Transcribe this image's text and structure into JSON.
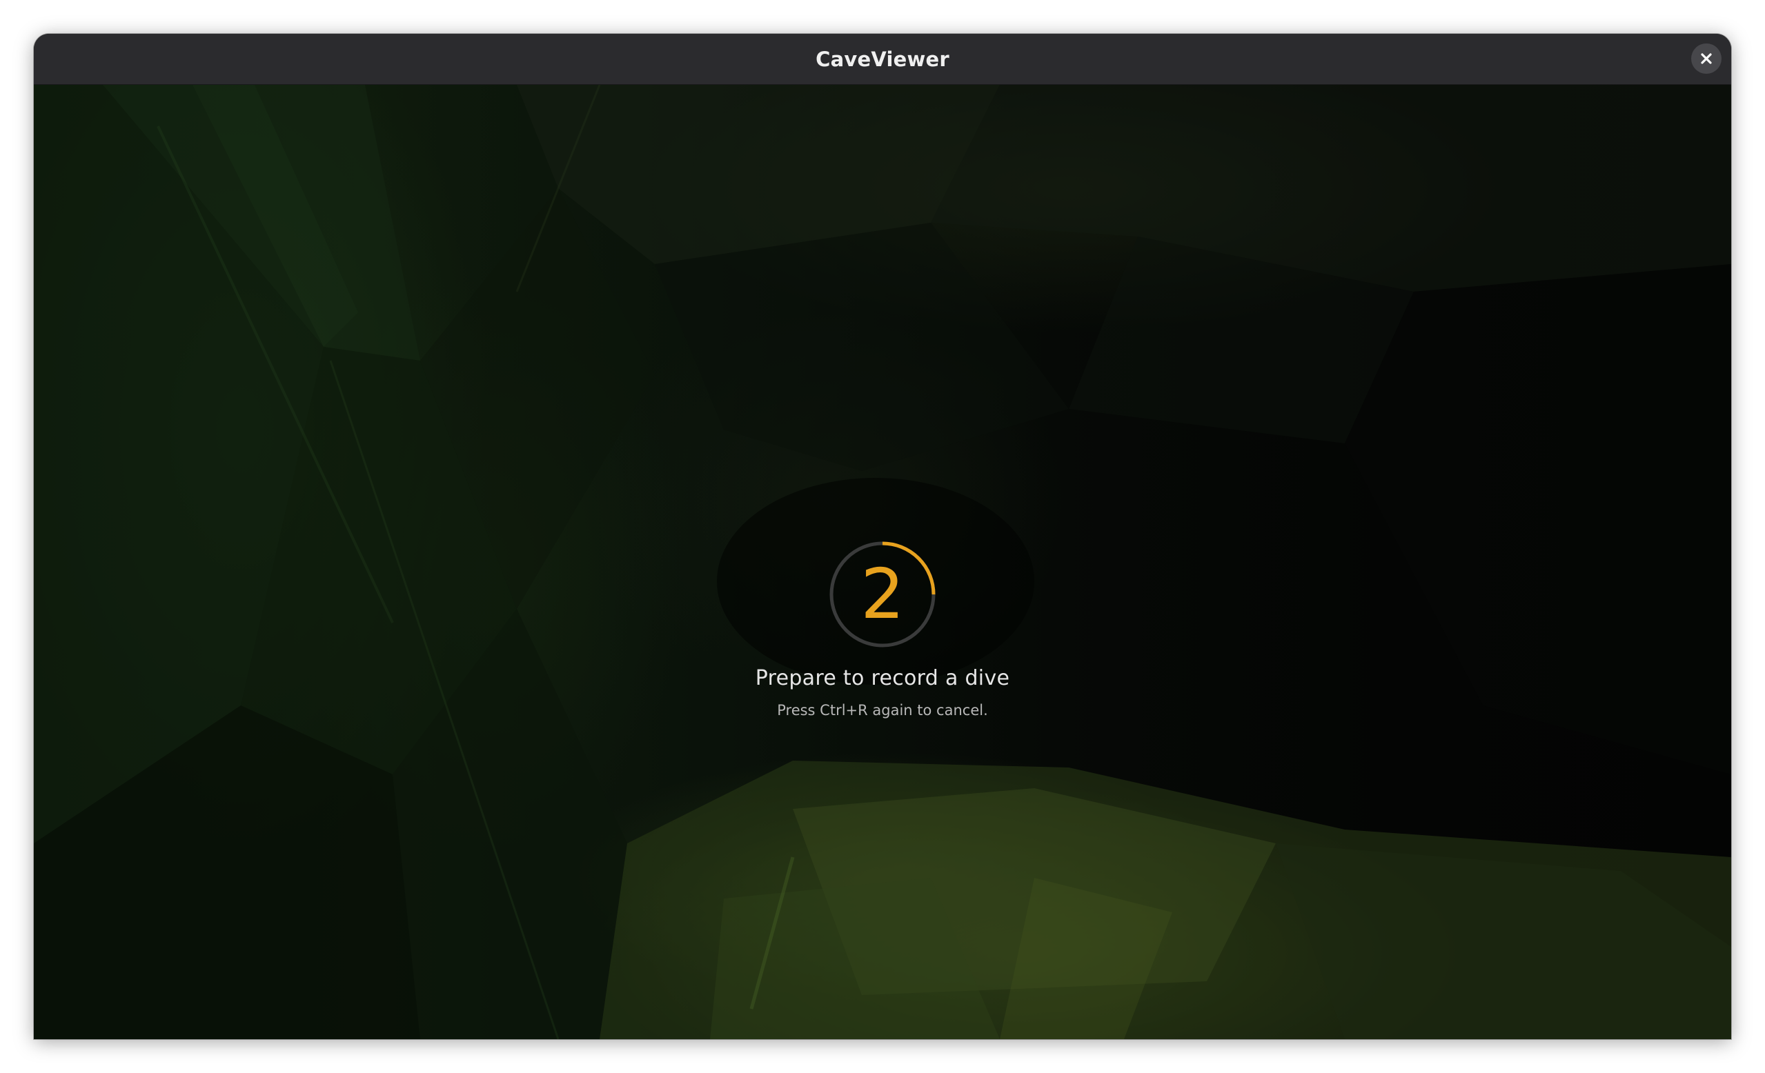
{
  "window": {
    "title": "CaveViewer",
    "close_icon": "close-icon"
  },
  "recording": {
    "countdown_value": "2",
    "countdown_progress": 0.25,
    "accent_color": "#e8a21e",
    "title": "Prepare to record a dive",
    "hint": "Press Ctrl+R again to cancel."
  }
}
